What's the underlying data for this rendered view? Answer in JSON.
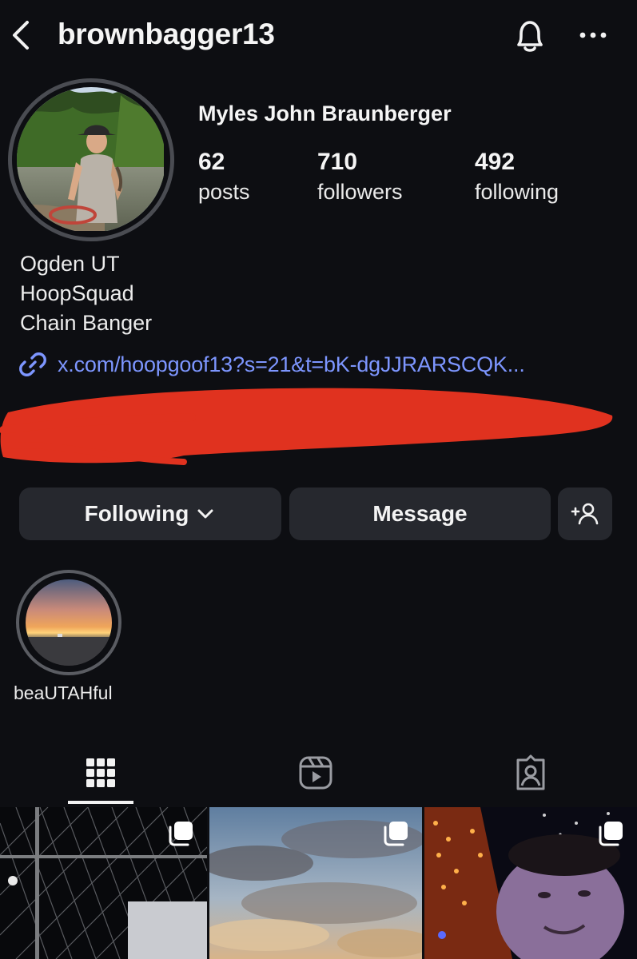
{
  "header": {
    "username": "brownbagger13",
    "back_icon": "chevron-left-icon",
    "notification_icon": "bell-icon",
    "more_icon": "more-horizontal-icon"
  },
  "profile": {
    "full_name": "Myles John Braunberger",
    "stats": [
      {
        "value": "62",
        "label": "posts"
      },
      {
        "value": "710",
        "label": "followers"
      },
      {
        "value": "492",
        "label": "following"
      }
    ],
    "bio_lines": [
      "Ogden UT",
      "HoopSquad",
      "Chain Banger"
    ],
    "link": "x.com/hoopgoof13?s=21&t=bK-dgJJRARSCQK...",
    "link_icon": "link-icon"
  },
  "actions": {
    "following_label": "Following",
    "message_label": "Message",
    "add_person_icon": "add-person-icon"
  },
  "highlights": [
    {
      "label": "beaUTAHful"
    }
  ],
  "tabs": [
    {
      "icon": "grid-icon",
      "active": true
    },
    {
      "icon": "reels-icon",
      "active": false
    },
    {
      "icon": "tagged-icon",
      "active": false
    }
  ],
  "colors": {
    "background": "#0d0e12",
    "button": "#26282e",
    "link": "#7d96ff",
    "redaction": "#e0321f"
  }
}
